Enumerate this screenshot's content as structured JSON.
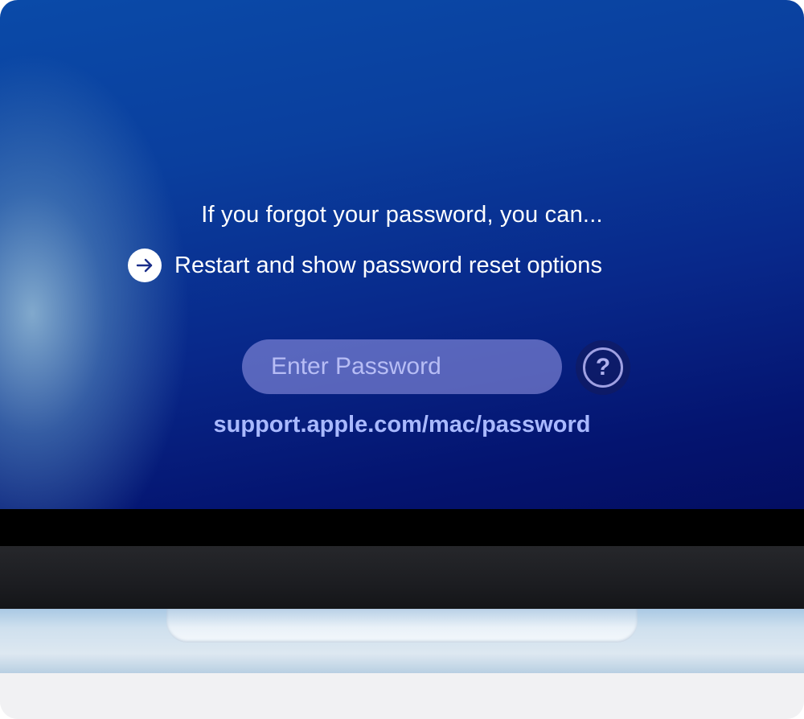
{
  "login_screen": {
    "forgot_prompt": "If you forgot your password, you can...",
    "restart_option_label": "Restart and show password reset options",
    "restart_icon": "arrow-right-circle-icon",
    "password_field": {
      "placeholder": "Enter Password",
      "value": ""
    },
    "help_button": {
      "icon": "question-mark-circle-icon",
      "glyph": "?"
    },
    "support_link": "support.apple.com/mac/password"
  },
  "colors": {
    "screen_top": "#0a4aa8",
    "screen_bottom": "#030e62",
    "link": "#a9b9ff",
    "text": "#ffffff"
  }
}
